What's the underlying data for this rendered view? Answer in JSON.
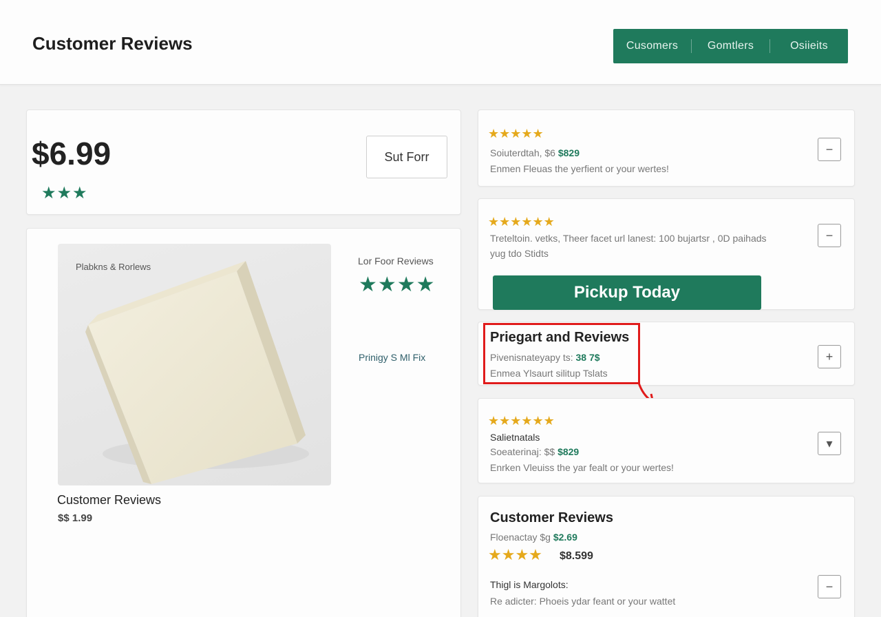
{
  "header": {
    "title": "Customer Reviews",
    "nav": [
      "Cusomers",
      "Gomtlers",
      "Osiieits"
    ]
  },
  "price_card": {
    "price": "$6.99",
    "stars": "★★★",
    "button_label": "Sut Forr"
  },
  "product_card": {
    "image_caption": "Plabkns & Rorlews",
    "name": "Customer Reviews",
    "price": "$$ 1.99",
    "side_label": "Lor Foor Reviews",
    "side_stars": "★★★★",
    "side_link": "Prinigy S Ml Fix"
  },
  "reviews": [
    {
      "stars": "★★★★★",
      "line1_text": "Soiuterdtah, $6 ",
      "line1_price": "$829",
      "line2": "Enmen Fleuas the yerfient or your wertes!",
      "button_icon": "−"
    },
    {
      "stars": "★★★★★★",
      "line1": "Treteltoin. vetks, Theer facet url lanest: 100 bujartsr , 0D paihads",
      "line2": "yug tdo Stidts",
      "button_icon": "−",
      "cta_label": "Pickup Today"
    },
    {
      "title": "Priegart and Reviews",
      "line1_text": "Pivenisnateyapy ts: ",
      "line1_price": "38 7$",
      "line2": "Enmea Ylsaurt silitup Tslats",
      "button_icon": "+"
    },
    {
      "stars": "★★★★★★",
      "label": "Salietnatals",
      "line1_text": "Soeaterinaj: $$ ",
      "line1_price": "$829",
      "line2": "Enrken Vleuiss the yar fealt or your wertes!",
      "button_icon": "▾"
    },
    {
      "title": "Customer Reviews",
      "line1_text": "Floenactay $g ",
      "line1_price": "$2.69",
      "stars": "★★★★",
      "price": "$8.599",
      "note": "Thigl is Margolots:",
      "line2": "Re adicter: Phoeis ydar feant or your wattet",
      "button_icon": "−"
    }
  ],
  "colors": {
    "brand_green": "#1f7a5c",
    "star_gold": "#e5a91c",
    "highlight_red": "#e01b1b"
  }
}
